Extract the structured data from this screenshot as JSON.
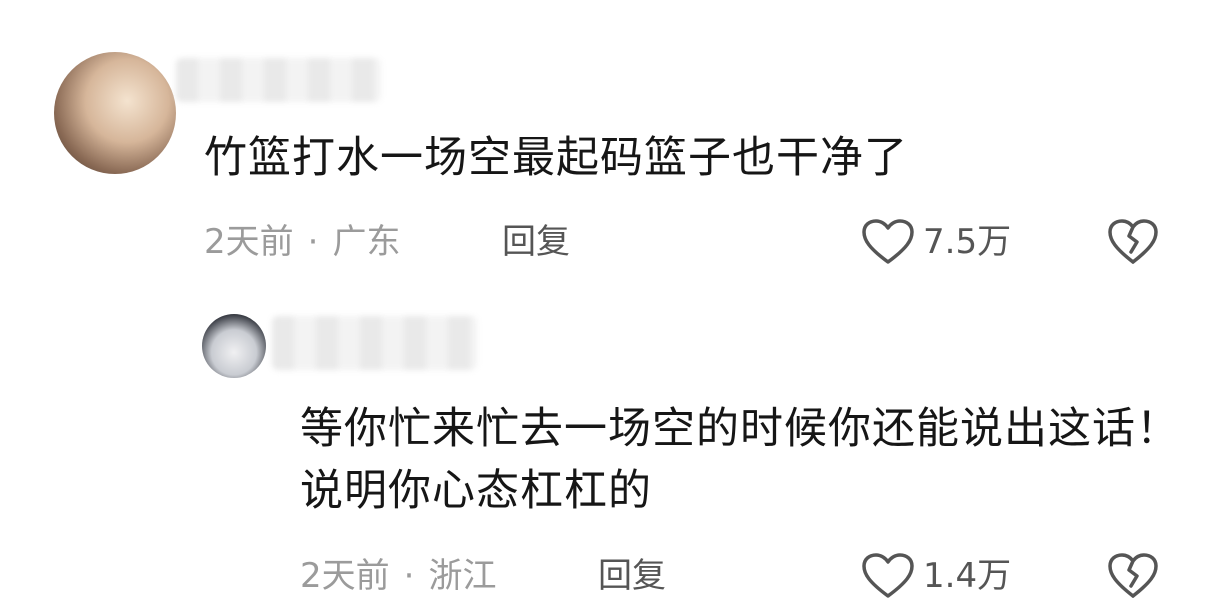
{
  "comments": [
    {
      "text": "竹篮打水一场空最起码篮子也干净了",
      "time": "2天前",
      "separator": "·",
      "location": "广东",
      "reply_label": "回复",
      "likes": "7.5万"
    },
    {
      "text": "等你忙来忙去一场空的时候你还能说出这话！说明你心态杠杠的",
      "time": "2天前",
      "separator": "·",
      "location": "浙江",
      "reply_label": "回复",
      "likes": "1.4万"
    }
  ],
  "icons": {
    "like": "heart-outline-icon",
    "dislike": "broken-heart-icon"
  },
  "colors": {
    "text": "#161616",
    "meta": "#9b9b9b",
    "action": "#555555"
  }
}
